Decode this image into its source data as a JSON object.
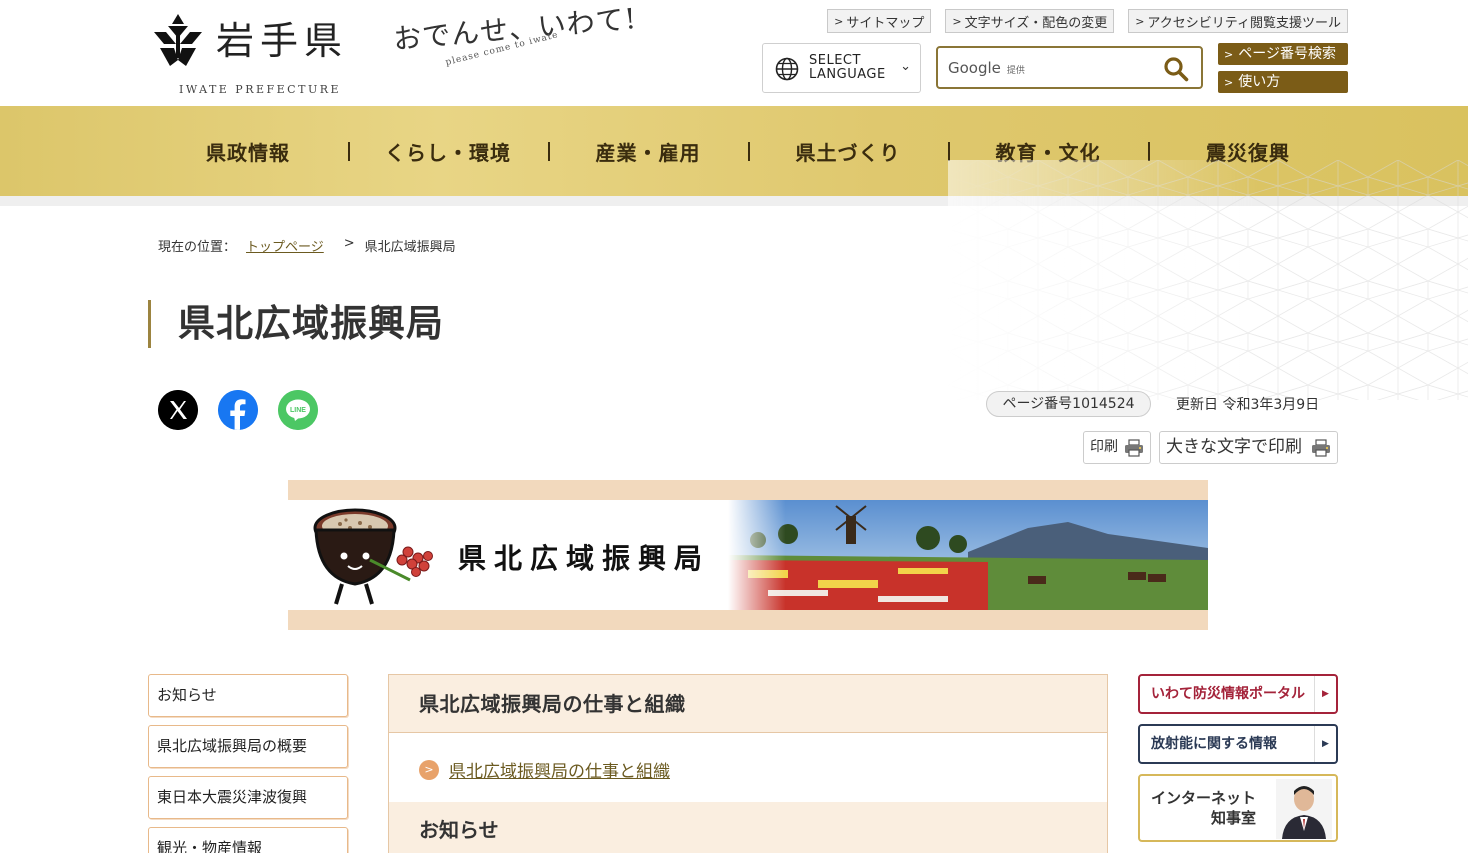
{
  "header": {
    "logo_text": "岩手県",
    "logo_sub": "IWATE PREFECTURE",
    "catchphrase": "おでんせ、いわて!",
    "catchphrase_sub": "please come to iwate",
    "util_links": [
      "サイトマップ",
      "文字サイズ・配色の変更",
      "アクセシビリティ閲覧支援ツール"
    ],
    "language_line1": "SELECT",
    "language_line2": "LANGUAGE",
    "search_brand": "Google",
    "search_brand_note": "提供",
    "page_search": "ページ番号検索",
    "usage": "使い方"
  },
  "gnav": [
    "県政情報",
    "くらし・環境",
    "産業・雇用",
    "県土づくり",
    "教育・文化",
    "震災復興"
  ],
  "breadcrumb": {
    "label": "現在の位置：",
    "home": "トップページ",
    "sep": ">",
    "current": "県北広域振興局"
  },
  "page": {
    "title": "県北広域振興局",
    "page_number": "ページ番号1014524",
    "updated": "更新日 令和3年3月9日",
    "print": "印刷",
    "print_large": "大きな文字で印刷"
  },
  "banner": {
    "title": "県北広域振興局"
  },
  "left_nav": [
    "お知らせ",
    "県北広域振興局の概要",
    "東日本大震災津波復興",
    "観光・物産情報"
  ],
  "main": {
    "section1_title": "県北広域振興局の仕事と組織",
    "section1_link": "県北広域振興局の仕事と組織",
    "section2_title": "お知らせ"
  },
  "right_nav": {
    "disaster": "いわて防災情報ポータル",
    "radiation": "放射能に関する情報",
    "governor_line1": "インターネット",
    "governor_line2": "知事室"
  },
  "colors": {
    "nav_gold": "#e8d585",
    "accent_brown": "#7b5c17",
    "disaster_red": "#a4233a",
    "radiation_navy": "#2b3a55"
  }
}
